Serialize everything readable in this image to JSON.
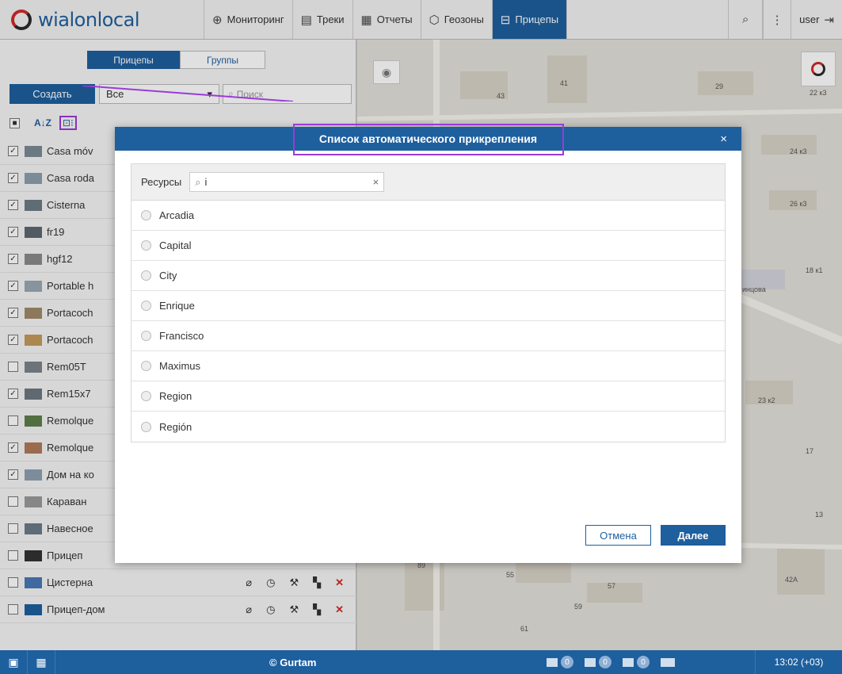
{
  "app": {
    "logo_text": "wialonlocal",
    "accent": "#1e5f9e",
    "highlight": "#9b3bd8"
  },
  "nav": {
    "items": [
      {
        "label": "Мониторинг",
        "icon": "globe-icon"
      },
      {
        "label": "Треки",
        "icon": "track-icon"
      },
      {
        "label": "Отчеты",
        "icon": "report-icon"
      },
      {
        "label": "Геозоны",
        "icon": "geofence-icon"
      },
      {
        "label": "Прицепы",
        "icon": "trailer-icon",
        "active": true
      }
    ],
    "user_label": "user"
  },
  "left": {
    "tabs": {
      "trailers": "Прицепы",
      "groups": "Группы"
    },
    "create_label": "Создать",
    "filter_value": "Все",
    "search_placeholder": "Поиск",
    "sort_label": "A↓Z",
    "rows": [
      {
        "name": "Casa móv",
        "checked": true
      },
      {
        "name": "Casa roda",
        "checked": true
      },
      {
        "name": "Cisterna",
        "checked": true
      },
      {
        "name": "fr19",
        "checked": true
      },
      {
        "name": "hgf12",
        "checked": true
      },
      {
        "name": "Portable h",
        "checked": true
      },
      {
        "name": "Portacoch",
        "checked": true
      },
      {
        "name": "Portacoch",
        "checked": true
      },
      {
        "name": "Rem05T",
        "checked": false
      },
      {
        "name": "Rem15x7",
        "checked": true
      },
      {
        "name": "Remolque",
        "checked": false
      },
      {
        "name": "Remolque",
        "checked": true
      },
      {
        "name": "Дом на ко",
        "checked": true
      },
      {
        "name": "Караван",
        "checked": false
      },
      {
        "name": "Навесное",
        "checked": false
      },
      {
        "name": "Прицеп",
        "checked": false
      },
      {
        "name": "Цистерна",
        "checked": false
      },
      {
        "name": "Прицеп-дом",
        "checked": false
      }
    ]
  },
  "map": {
    "labels": [
      "41",
      "43",
      "29",
      "22 к3",
      "24 к3",
      "26 к3",
      "18 к1",
      "инцова",
      "23 к2",
      "17",
      "13",
      "42А",
      "89",
      "55",
      "57",
      "59",
      "61"
    ]
  },
  "dialog": {
    "title": "Список автоматического прикрепления",
    "resources_label": "Ресурсы",
    "search_value": "i",
    "clear": "×",
    "close": "×",
    "resources": [
      "Arcadia",
      "Capital",
      "City",
      "Enrique",
      "Francisco",
      "Maximus",
      "Region",
      "Región"
    ],
    "cancel_label": "Отмена",
    "next_label": "Далее"
  },
  "bottom": {
    "copyright": "© Gurtam",
    "counters": [
      "0",
      "0",
      "0"
    ],
    "time": "13:02 (+03)"
  }
}
